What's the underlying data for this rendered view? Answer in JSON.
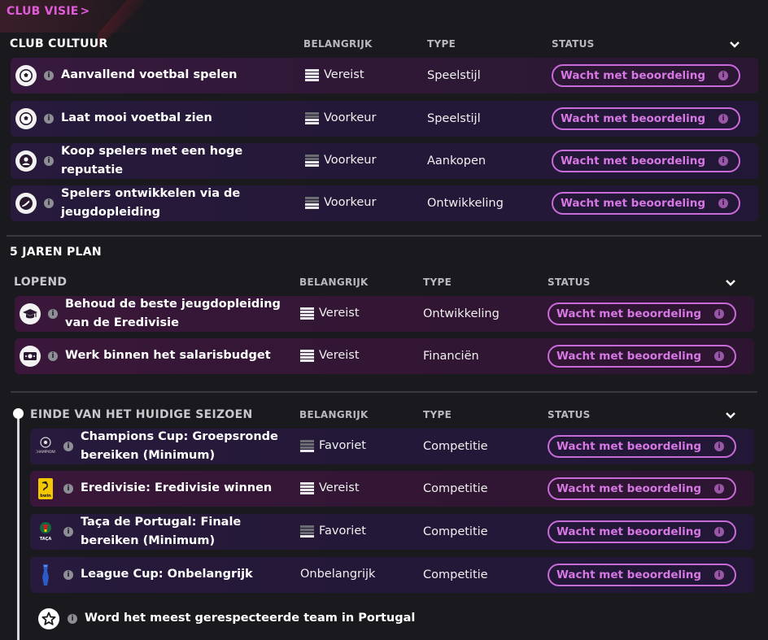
{
  "breadcrumb": {
    "label": "CLUB VISIE",
    "chevron": ">"
  },
  "club_culture": {
    "title": "CLUB CULTUUR",
    "headers": {
      "importance": "BELANGRIJK",
      "type": "TYPE",
      "status": "STATUS"
    },
    "rows": [
      {
        "icon": "football-icon",
        "line1": "Aanvallend voetbal spelen",
        "line2": "",
        "importance": "Vereist",
        "importance_level": 3,
        "type": "Speelstijl",
        "status": "Wacht met beoordeling"
      },
      {
        "icon": "football-icon",
        "line1": "Laat mooi voetbal zien",
        "line2": "",
        "importance": "Voorkeur",
        "importance_level": 2,
        "type": "Speelstijl",
        "status": "Wacht met beoordeling"
      },
      {
        "icon": "person-icon",
        "line1": "Koop spelers met een hoge",
        "line2": "reputatie",
        "importance": "Voorkeur",
        "importance_level": 2,
        "type": "Aankopen",
        "status": "Wacht met beoordeling"
      },
      {
        "icon": "boot-icon",
        "line1": "Spelers ontwikkelen via de",
        "line2": "jeugdopleiding",
        "importance": "Voorkeur",
        "importance_level": 2,
        "type": "Ontwikkeling",
        "status": "Wacht met beoordeling"
      }
    ]
  },
  "five_year_plan": {
    "title": "5 JAREN PLAN",
    "ongoing": {
      "title": "LOPEND",
      "headers": {
        "importance": "BELANGRIJK",
        "type": "TYPE",
        "status": "STATUS"
      },
      "rows": [
        {
          "icon": "graduation-cap-icon",
          "line1": "Behoud de beste jeugdopleiding",
          "line2": "van de Eredivisie",
          "importance": "Vereist",
          "importance_level": 3,
          "type": "Ontwikkeling",
          "status": "Wacht met beoordeling"
        },
        {
          "icon": "money-icon",
          "line1": "Werk binnen het salarisbudget",
          "line2": "",
          "importance": "Vereist",
          "importance_level": 3,
          "type": "Financiën",
          "status": "Wacht met beoordeling"
        }
      ]
    },
    "season_end": {
      "title": "EINDE VAN HET HUIDIGE SEIZOEN",
      "headers": {
        "importance": "BELANGRIJK",
        "type": "TYPE",
        "status": "STATUS"
      },
      "rows": [
        {
          "icon": "champions-cup-logo-icon",
          "logo_text": "CHAMPIONS",
          "line1": "Champions Cup: Groepsronde",
          "line2": "bereiken (Minimum)",
          "importance": "Favoriet",
          "importance_level": 1,
          "type": "Competitie",
          "status": "Wacht met beoordeling"
        },
        {
          "icon": "eredivisie-logo-icon",
          "logo_text": "bwin",
          "line1": "Eredivisie: Eredivisie winnen",
          "line2": "",
          "importance": "Vereist",
          "importance_level": 3,
          "type": "Competitie",
          "status": "Wacht met beoordeling"
        },
        {
          "icon": "taca-logo-icon",
          "logo_text": "TAÇA",
          "line1": "Taça de Portugal: Finale",
          "line2": "bereiken (Minimum)",
          "importance": "Favoriet",
          "importance_level": 1,
          "type": "Competitie",
          "status": "Wacht met beoordeling"
        },
        {
          "icon": "league-cup-logo-icon",
          "line1": "League Cup: Onbelangrijk",
          "line2": "",
          "importance": "Onbelangrijk",
          "importance_level": 0,
          "type": "Competitie",
          "status": "Wacht met beoordeling"
        }
      ]
    },
    "long_term": {
      "icon": "star-icon",
      "label": "Word het meest gerespecteerde team in Portugal"
    }
  },
  "colors": {
    "accent": "#d777e3",
    "breadcrumb": "#e05bd8",
    "background": "#1a1a1e"
  }
}
